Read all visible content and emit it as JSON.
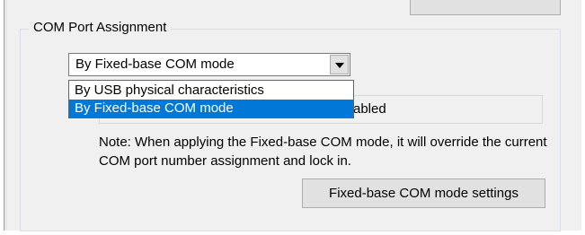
{
  "group": {
    "title": "COM Port Assignment"
  },
  "combo": {
    "selected": "By Fixed-base COM mode"
  },
  "dropdown": {
    "options": [
      "By USB physical characteristics",
      "By Fixed-base COM mode"
    ],
    "selected_index": 1
  },
  "status": {
    "text": "abled"
  },
  "note": {
    "text": "Note: When applying the Fixed-base COM mode, it will override the current COM port number assignment and lock in."
  },
  "buttons": {
    "settings_label": "Fixed-base COM mode settings"
  },
  "colors": {
    "selection": "#0078d7",
    "dialog_bg": "#f0f0f0"
  }
}
